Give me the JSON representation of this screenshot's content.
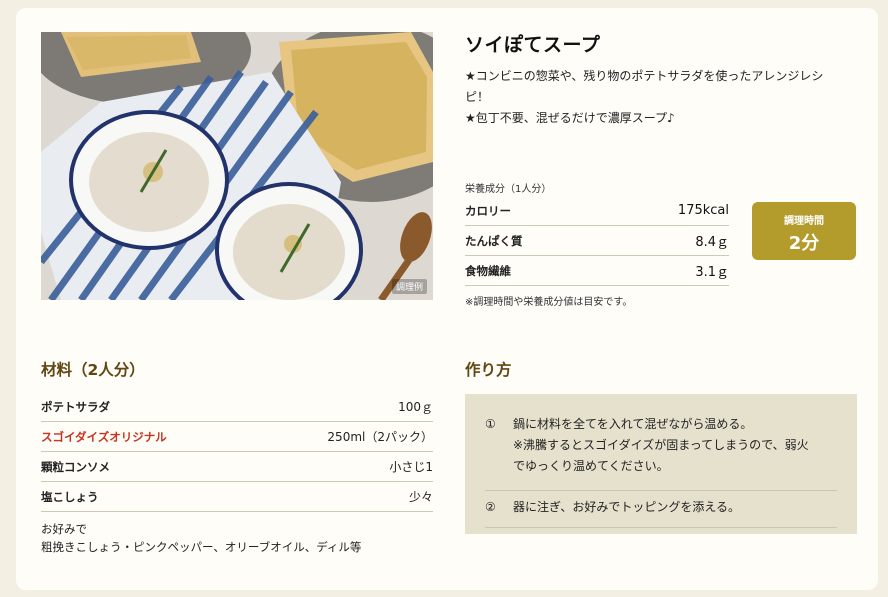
{
  "recipe": {
    "title": "ソイぽてスープ",
    "desc_lines": [
      "★コンビニの惣菜や、残り物のポテトサラダを使ったアレンジレシピ！",
      "★包丁不要、混ぜるだけで濃厚スープ♪"
    ],
    "photo_badge": "調理例"
  },
  "nutrition": {
    "caption": "栄養成分（1人分）",
    "rows": [
      {
        "label": "カロリー",
        "value": "175kcal"
      },
      {
        "label": "たんぱく質",
        "value": "8.4ｇ"
      },
      {
        "label": "食物繊維",
        "value": "3.1ｇ"
      }
    ],
    "note": "※調理時間や栄養成分値は目安です。"
  },
  "cook_time": {
    "label": "調理時間",
    "value": "2分",
    "color": "#b39c2b"
  },
  "ingredients": {
    "title": "材料（2人分）",
    "rows": [
      {
        "name": "ポテトサラダ",
        "amount": "100ｇ"
      },
      {
        "name": "スゴイダイズオリジナル",
        "amount": "250ml（2パック）"
      },
      {
        "name": "顆粒コンソメ",
        "amount": "小さじ1"
      },
      {
        "name": "塩こしょう",
        "amount": "少々"
      }
    ],
    "accent_color": "#c8321e",
    "extra_lines": [
      "お好みで",
      "粗挽きこしょう・ピンクペッパー、オリーブオイル、ディル等"
    ]
  },
  "method": {
    "title": "作り方",
    "steps": [
      {
        "num": "①",
        "lines": [
          "鍋に材料を全てを入れて混ぜながら温める。",
          "※沸騰するとスゴイダイズが固まってしまうので、弱火",
          "でゆっくり温めてください。"
        ]
      },
      {
        "num": "②",
        "lines": [
          "器に注ぎ、お好みでトッピングを添える。"
        ]
      }
    ]
  }
}
